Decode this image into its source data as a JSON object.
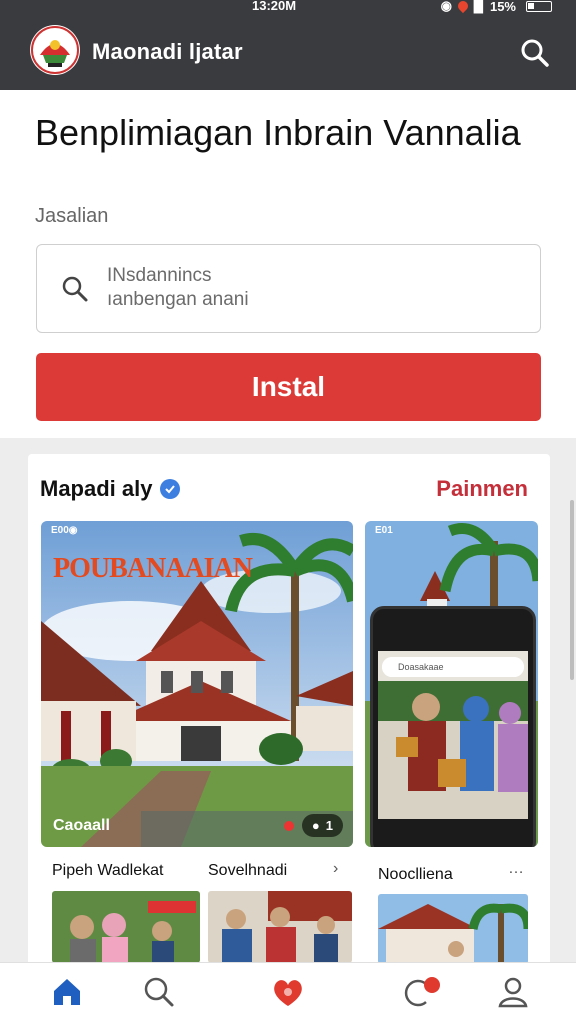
{
  "status_bar": {
    "time": "13:20M",
    "battery": "15%"
  },
  "app_bar": {
    "title": "Maonadi ljatar"
  },
  "page": {
    "title": "Benplimiagan Inbrain Vannalia",
    "subtitle": "Jasalian",
    "search": {
      "placeholder_line1": "INsdannincs",
      "placeholder_line2": "ıanbengan anani"
    },
    "install_label": "Instal"
  },
  "feed": {
    "header": "Mapadi aly",
    "link": "Painmen",
    "main_post": {
      "banner": "POUBANAAIAN",
      "caption": "Caoaall",
      "count": "1"
    },
    "side_post": {
      "mini_status": "E01",
      "phone_search": "Doasakaae"
    },
    "row_labels": [
      "Pipeh Wadlekat",
      "Sovelhnadi",
      "Nooclliena"
    ],
    "more": "…",
    "arrow": "›"
  },
  "bottom_nav": {
    "items": [
      {
        "icon": "home-icon"
      },
      {
        "icon": "search-icon"
      },
      {
        "icon": "heart-icon"
      },
      {
        "icon": "notification-icon"
      },
      {
        "icon": "profile-icon"
      }
    ]
  },
  "colors": {
    "app_bar": "#3a3b3e",
    "accent_red": "#dc3a36",
    "link_red": "#c42f3a",
    "home_blue": "#1f5fbf"
  }
}
